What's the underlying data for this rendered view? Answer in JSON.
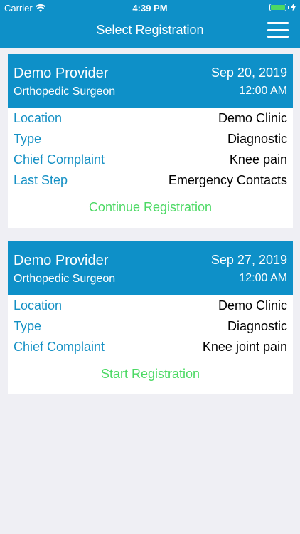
{
  "status_bar": {
    "carrier": "Carrier",
    "time": "4:39 PM"
  },
  "nav": {
    "title": "Select Registration"
  },
  "registrations": [
    {
      "provider": "Demo Provider",
      "specialty": "Orthopedic Surgeon",
      "date": "Sep 20, 2019",
      "time": "12:00 AM",
      "fields": [
        {
          "label": "Location",
          "value": "Demo Clinic"
        },
        {
          "label": "Type",
          "value": "Diagnostic"
        },
        {
          "label": "Chief Complaint",
          "value": "Knee pain"
        },
        {
          "label": "Last Step",
          "value": "Emergency Contacts"
        }
      ],
      "action": "Continue Registration"
    },
    {
      "provider": "Demo Provider",
      "specialty": "Orthopedic Surgeon",
      "date": "Sep 27, 2019",
      "time": "12:00 AM",
      "fields": [
        {
          "label": "Location",
          "value": "Demo Clinic"
        },
        {
          "label": "Type",
          "value": "Diagnostic"
        },
        {
          "label": "Chief Complaint",
          "value": "Knee joint pain"
        }
      ],
      "action": "Start Registration"
    }
  ],
  "colors": {
    "header": "#0e90c8",
    "label": "#1490c4",
    "action": "#4cd964",
    "background": "#efeff4"
  }
}
